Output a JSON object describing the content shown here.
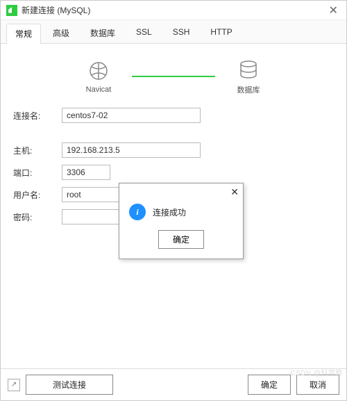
{
  "window": {
    "title": "新建连接 (MySQL)"
  },
  "tabs": {
    "general": "常规",
    "advanced": "高级",
    "database": "数据库",
    "ssl": "SSL",
    "ssh": "SSH",
    "http": "HTTP"
  },
  "diagram": {
    "left": "Navicat",
    "right": "数据库"
  },
  "fields": {
    "conn_name": {
      "label": "连接名:",
      "value": "centos7-02"
    },
    "host": {
      "label": "主机:",
      "value": "192.168.213.5"
    },
    "port": {
      "label": "端口:",
      "value": "3306"
    },
    "user": {
      "label": "用户名:",
      "value": "root"
    },
    "password": {
      "label": "密码:",
      "value": ""
    }
  },
  "dialog": {
    "message": "连接成功",
    "ok": "确定"
  },
  "footer": {
    "test": "测试连接",
    "ok": "确定",
    "cancel": "取消"
  },
  "watermark": "CSDN @科学熊"
}
